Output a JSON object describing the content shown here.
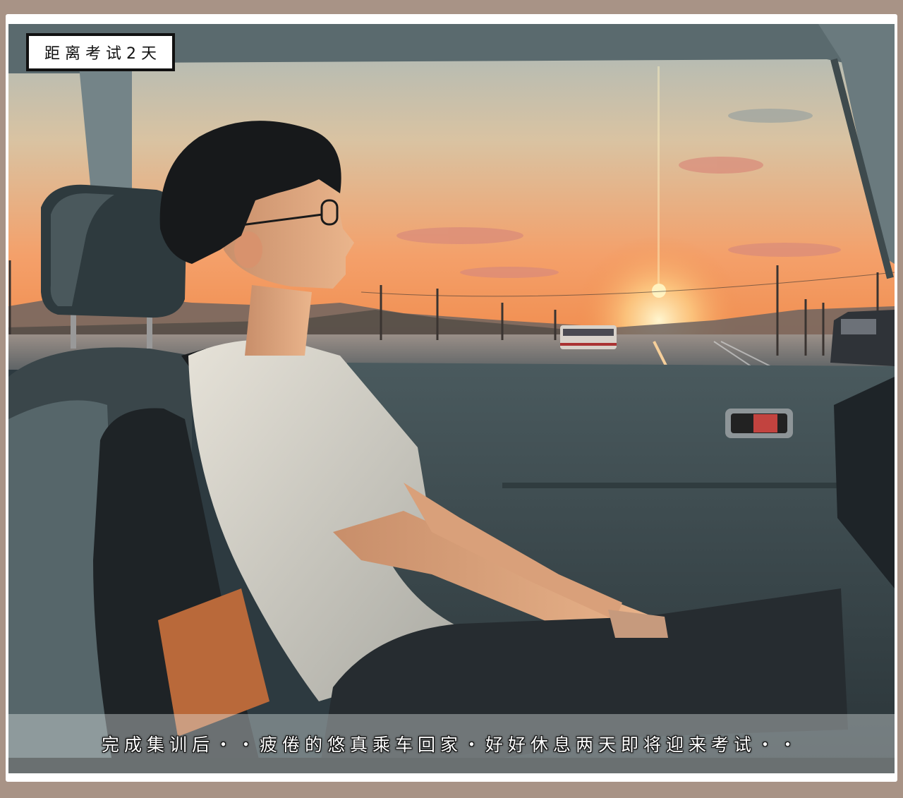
{
  "badge": {
    "text": "距离考试2天"
  },
  "caption": {
    "text": "完成集训后・・疲倦的悠真乘车回家・好好休息两天即将迎来考试・・"
  },
  "colors": {
    "frame": "#a89386",
    "card": "#ffffff",
    "badge_border": "#111111",
    "sky_top": "#a9b9b9",
    "sky_horizon": "#f08a4a",
    "sun": "#fff2c0",
    "car_interior": "#3a4a50"
  }
}
